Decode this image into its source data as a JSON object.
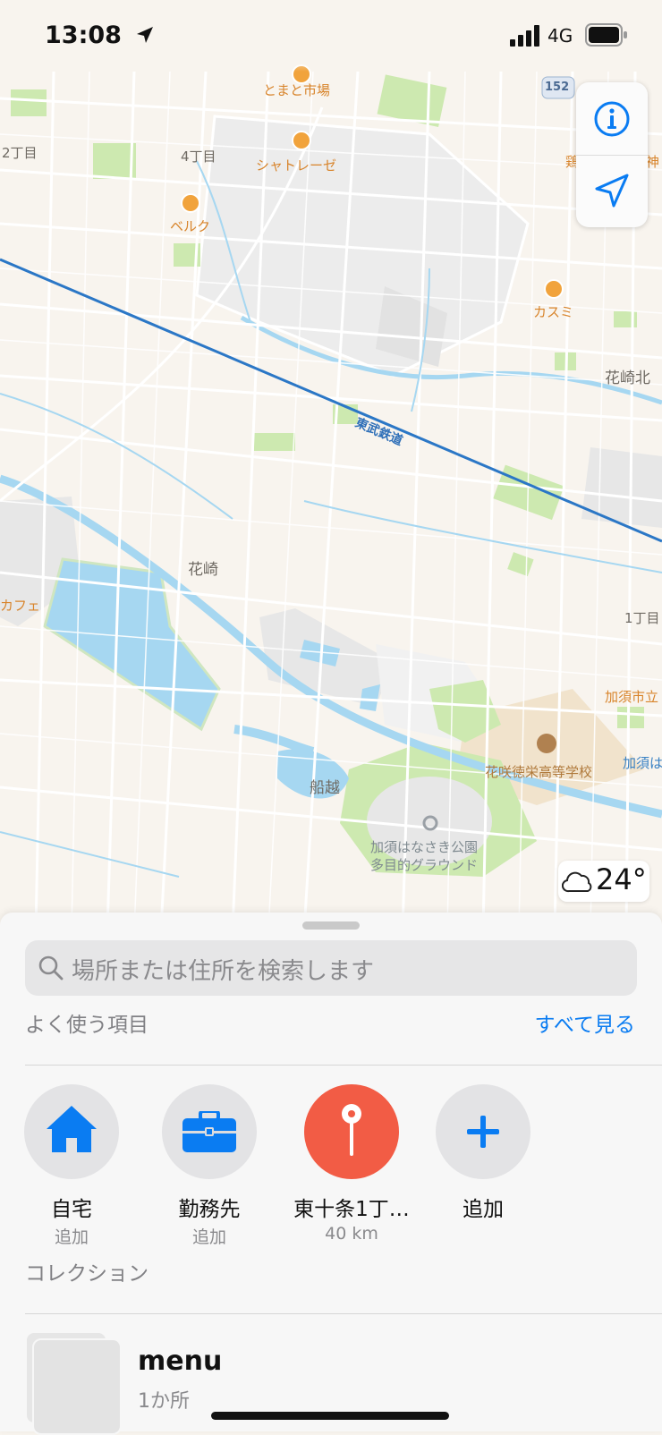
{
  "status_bar": {
    "time": "13:08",
    "network": "4G"
  },
  "map": {
    "labels": {
      "tomato_market": "とまと市場",
      "route_152": "152",
      "chome2": "2丁目",
      "chome4": "4丁目",
      "chateraise": "シャトレーゼ",
      "belc": "ベルク",
      "kasumi": "カスミ",
      "hanasaki_kita": "花崎北",
      "tobu_railway": "東武鉄道",
      "hanasaki": "花崎",
      "cafe": "カフェ",
      "chome1": "1丁目",
      "kazo_city": "加須市立",
      "school": "花咲徳栄高等学校",
      "funakoshi": "船越",
      "park_line1": "加須はなさき公園",
      "park_line2": "多目的グラウンド",
      "kazo_edge": "加須は",
      "edge_top1": "鶏",
      "edge_top2": "神"
    },
    "icons": {
      "info": "info-icon",
      "locate": "location-arrow-icon",
      "weather": "cloud-icon"
    },
    "weather_temp": "24°"
  },
  "sheet": {
    "search_placeholder": "場所または住所を検索します",
    "favorites": {
      "title": "よく使う項目",
      "see_all": "すべて見る",
      "items": [
        {
          "name": "自宅",
          "sub": "追加",
          "icon": "home-icon"
        },
        {
          "name": "勤務先",
          "sub": "追加",
          "icon": "briefcase-icon"
        },
        {
          "name": "東十条1丁…",
          "sub": "40 km",
          "icon": "pin-icon"
        },
        {
          "name": "追加",
          "sub": "",
          "icon": "plus-icon"
        }
      ]
    },
    "collections": {
      "title": "コレクション",
      "items": [
        {
          "name": "menu",
          "sub": "1か所"
        }
      ]
    }
  },
  "colors": {
    "accent": "#0a7cf2",
    "pin": "#f25c45",
    "railway": "#2b77c6",
    "water": "#a6d7f1",
    "park": "#cde9b0"
  }
}
